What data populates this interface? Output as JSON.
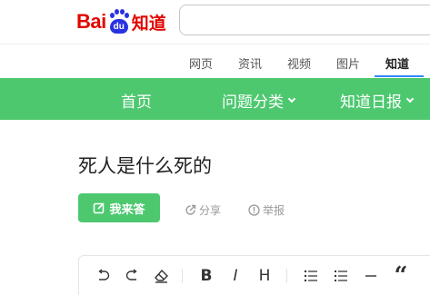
{
  "logo": {
    "part1": "Bai",
    "paw_text": "du",
    "part2": "知道"
  },
  "search": {
    "value": "",
    "placeholder": ""
  },
  "channels": [
    {
      "label": "网页",
      "active": false
    },
    {
      "label": "资讯",
      "active": false
    },
    {
      "label": "视频",
      "active": false
    },
    {
      "label": "图片",
      "active": false
    },
    {
      "label": "知道",
      "active": true
    }
  ],
  "nav": {
    "items": [
      {
        "label": "首页",
        "has_dropdown": false
      },
      {
        "label": "问题分类",
        "has_dropdown": true
      },
      {
        "label": "知道日报",
        "has_dropdown": true
      }
    ],
    "background": "#4dc86f"
  },
  "question": {
    "title": "死人是什么死的"
  },
  "actions": {
    "answer_label": "我来答",
    "share_label": "分享",
    "report_label": "举报"
  },
  "editor": {
    "tools": [
      "undo-icon",
      "redo-icon",
      "eraser-icon",
      "bold-icon",
      "italic-icon",
      "heading-icon",
      "unordered-list-icon",
      "ordered-list-icon",
      "horizontal-rule-icon",
      "quote-icon"
    ],
    "bold_glyph": "B",
    "italic_glyph": "I",
    "heading_glyph": "H",
    "quote_glyph": "“"
  },
  "colors": {
    "brand_red": "#e10601",
    "brand_blue": "#2932e1",
    "accent_green": "#4dc86f",
    "active_tab_underline": "#3388ff"
  }
}
